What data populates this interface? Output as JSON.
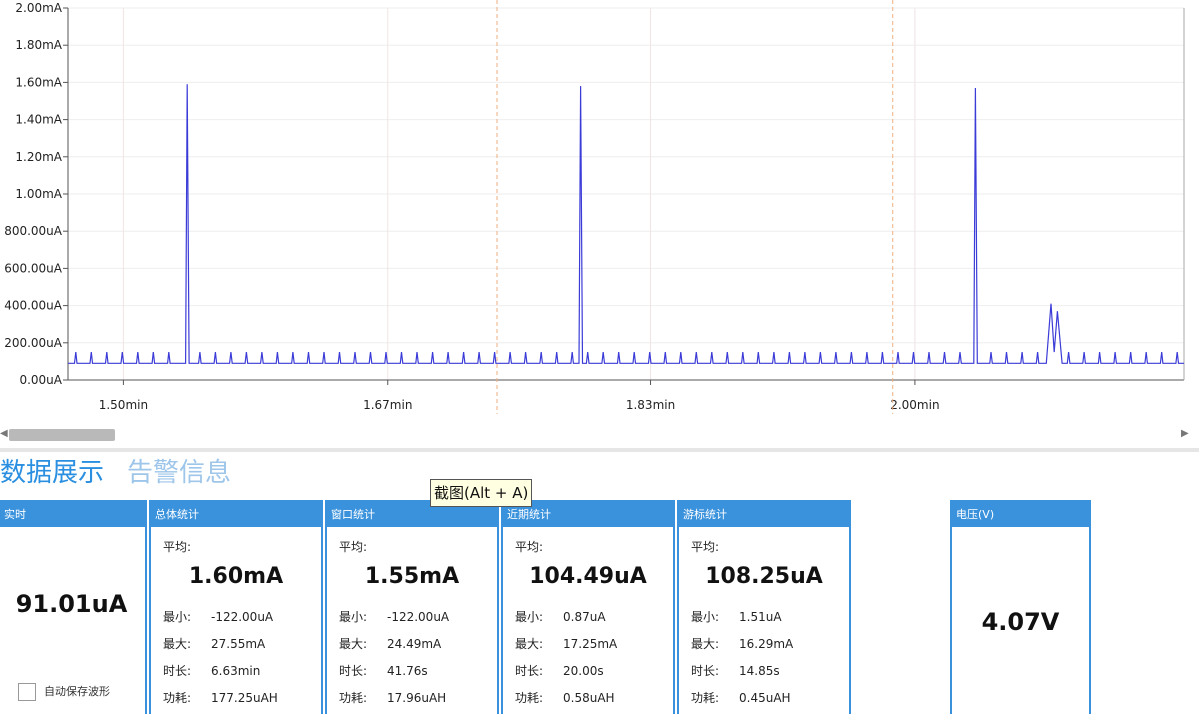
{
  "chart_data": {
    "type": "line",
    "title": "",
    "xlabel": "",
    "ylabel": "",
    "y_ticks": [
      "0.00uA",
      "200.00uA",
      "400.00uA",
      "600.00uA",
      "800.00uA",
      "1.00mA",
      "1.20mA",
      "1.40mA",
      "1.60mA",
      "1.80mA",
      "2.00mA"
    ],
    "y_tick_values_uA": [
      0,
      200,
      400,
      600,
      800,
      1000,
      1200,
      1400,
      1600,
      1800,
      2000
    ],
    "ylim_uA": [
      0,
      2000
    ],
    "x_ticks": [
      "1.50min",
      "1.67min",
      "1.83min",
      "2.00min"
    ],
    "x_tick_values_min": [
      1.5,
      1.667,
      1.833,
      2.0
    ],
    "xlim_min": [
      1.465,
      2.17
    ],
    "cursor_lines_min": [
      1.736,
      1.986
    ],
    "grid": true,
    "series": [
      {
        "color": "#3b3bd8",
        "baseline_uA": 90,
        "pulse_peak_uA": 150,
        "pulse_period_min": 0.0098,
        "spikes": [
          {
            "x": 1.5,
            "y": 0
          },
          {
            "x": 1.5393,
            "y": 90
          },
          {
            "x": 1.5403,
            "y": 1590
          },
          {
            "x": 1.5415,
            "y": 90
          },
          {
            "x": 1.7878,
            "y": 90
          },
          {
            "x": 1.7888,
            "y": 1580
          },
          {
            "x": 1.79,
            "y": 90
          },
          {
            "x": 2.0372,
            "y": 90
          },
          {
            "x": 2.0382,
            "y": 1570
          },
          {
            "x": 2.0394,
            "y": 90
          },
          {
            "x": 2.083,
            "y": 90
          },
          {
            "x": 2.086,
            "y": 410
          },
          {
            "x": 2.088,
            "y": 150
          },
          {
            "x": 2.09,
            "y": 370
          },
          {
            "x": 2.093,
            "y": 90
          }
        ]
      }
    ]
  },
  "scrollbar": {
    "left_arrow": "◀",
    "right_arrow": "▶"
  },
  "tabs": {
    "data_display": "数据展示",
    "alert_info": "告警信息"
  },
  "tooltip": {
    "text": "截图(Alt + A)"
  },
  "panels": {
    "realtime": {
      "title": "实时",
      "value": "91.01uA",
      "auto_save_label": "自动保存波形",
      "auto_save_checked": false
    },
    "overall": {
      "title": "总体统计",
      "avg_label": "平均:",
      "avg": "1.60mA",
      "min_label": "最小:",
      "min": "-122.00uA",
      "max_label": "最大:",
      "max": "27.55mA",
      "duration_label": "时长:",
      "duration": "6.63min",
      "energy_label": "功耗:",
      "energy": "177.25uAH"
    },
    "window": {
      "title": "窗口统计",
      "avg_label": "平均:",
      "avg": "1.55mA",
      "min_label": "最小:",
      "min": "-122.00uA",
      "max_label": "最大:",
      "max": "24.49mA",
      "duration_label": "时长:",
      "duration": "41.76s",
      "energy_label": "功耗:",
      "energy": "17.96uAH"
    },
    "recent": {
      "title": "近期统计",
      "avg_label": "平均:",
      "avg": "104.49uA",
      "min_label": "最小:",
      "min": "0.87uA",
      "max_label": "最大:",
      "max": "17.25mA",
      "duration_label": "时长:",
      "duration": "20.00s",
      "energy_label": "功耗:",
      "energy": "0.58uAH"
    },
    "cursor": {
      "title": "游标统计",
      "avg_label": "平均:",
      "avg": "108.25uA",
      "min_label": "最小:",
      "min": "1.51uA",
      "max_label": "最大:",
      "max": "16.29mA",
      "duration_label": "时长:",
      "duration": "14.85s",
      "energy_label": "功耗:",
      "energy": "0.45uAH"
    },
    "voltage": {
      "title": "电压(V)",
      "value": "4.07V"
    }
  },
  "colors": {
    "accent": "#3a92dc",
    "tab_active": "#2a8fe0",
    "tab_inactive": "#9ec6ea",
    "cursor_line": "#f0b080",
    "series": "#3b3bd8"
  }
}
